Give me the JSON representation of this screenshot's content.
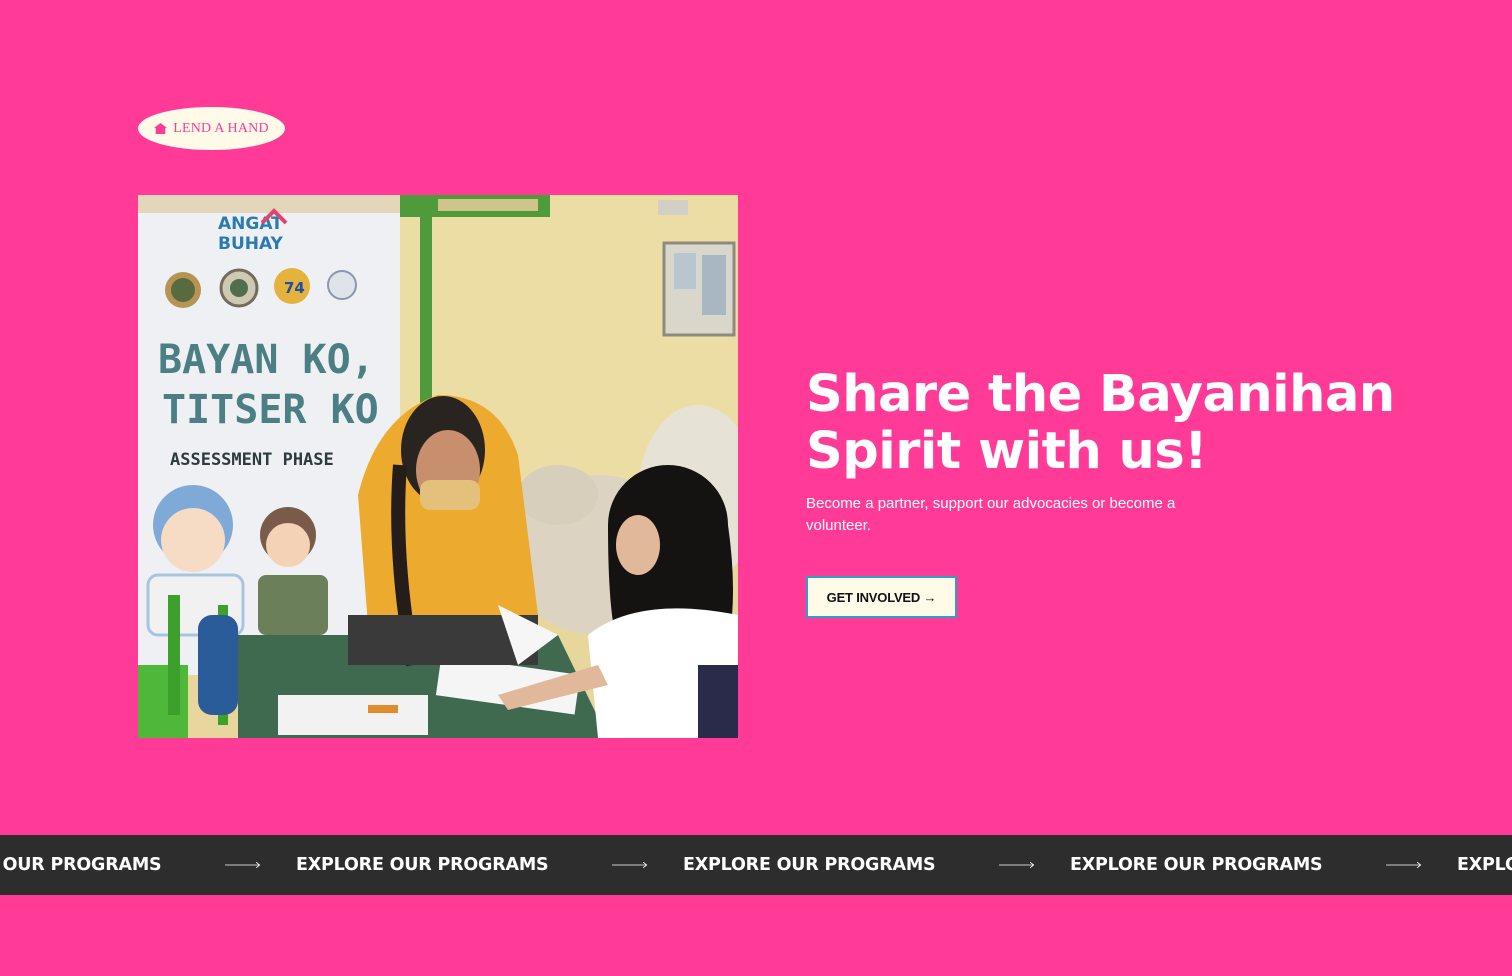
{
  "tag": {
    "label": "LEND A HAND",
    "icon": "house-icon"
  },
  "photo": {
    "banner_logo_line1": "ANGAT",
    "banner_logo_line2": "BUHAY",
    "banner_title_line1": "BAYAN KO,",
    "banner_title_line2": "TITSER KO",
    "banner_subtitle": "ASSESSMENT PHASE",
    "seal_label": "74"
  },
  "hero": {
    "title": "Share the Bayanihan Spirit with us!",
    "subtitle": "Become a partner, support our advocacies or become a volunteer.",
    "cta_label": "GET INVOLVED →"
  },
  "marquee": {
    "items": [
      "EXPLORE OUR PROGRAMS",
      "EXPLORE OUR PROGRAMS",
      "EXPLORE OUR PROGRAMS",
      "EXPLORE OUR PROGRAMS",
      "EXPLORE OUR PROGRAMS"
    ],
    "separator_icon": "long-arrow-right-icon"
  },
  "colors": {
    "background": "#ff3b97",
    "cream": "#fffbe8",
    "marquee_bg": "#2d2d2d",
    "cta_border": "#2e9fc5"
  }
}
